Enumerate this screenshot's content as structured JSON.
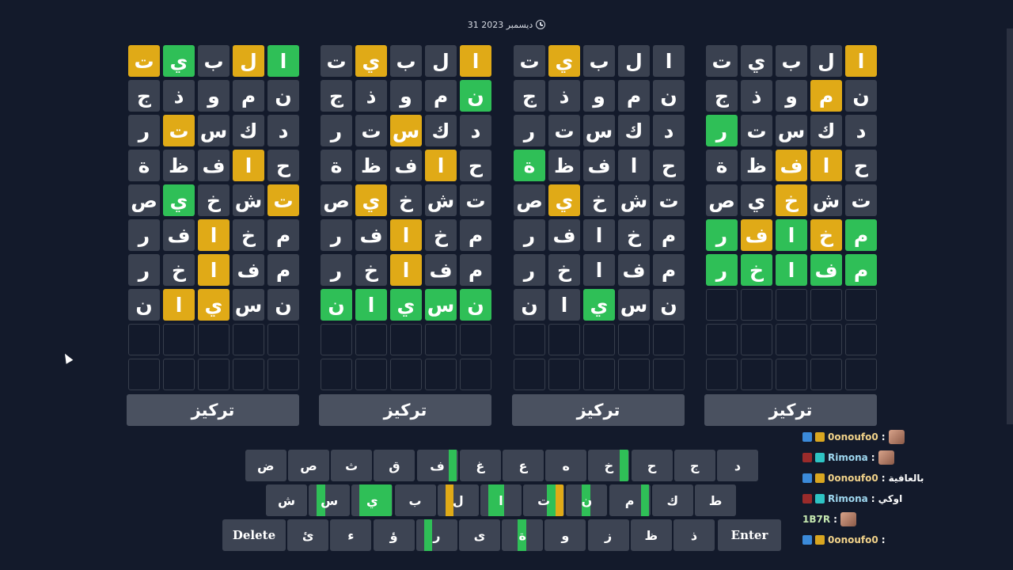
{
  "date": "31 ديسمبر 2023",
  "boards": [
    {
      "rows": [
        [
          [
            "ا",
            "y"
          ],
          [
            "ل",
            ""
          ],
          [
            "ب",
            ""
          ],
          [
            "ي",
            ""
          ],
          [
            "ت",
            ""
          ]
        ],
        [
          [
            "ن",
            ""
          ],
          [
            "م",
            "y"
          ],
          [
            "و",
            ""
          ],
          [
            "ذ",
            ""
          ],
          [
            "ج",
            ""
          ]
        ],
        [
          [
            "د",
            ""
          ],
          [
            "ك",
            ""
          ],
          [
            "س",
            ""
          ],
          [
            "ت",
            ""
          ],
          [
            "ر",
            "g"
          ]
        ],
        [
          [
            "ح",
            ""
          ],
          [
            "ا",
            "y"
          ],
          [
            "ف",
            "y"
          ],
          [
            "ظ",
            ""
          ],
          [
            "ة",
            ""
          ]
        ],
        [
          [
            "ت",
            ""
          ],
          [
            "ش",
            ""
          ],
          [
            "خ",
            "y"
          ],
          [
            "ي",
            ""
          ],
          [
            "ص",
            ""
          ]
        ],
        [
          [
            "م",
            "g"
          ],
          [
            "خ",
            "y"
          ],
          [
            "ا",
            "g"
          ],
          [
            "ف",
            "y"
          ],
          [
            "ر",
            "g"
          ]
        ],
        [
          [
            "م",
            "g"
          ],
          [
            "ف",
            "g"
          ],
          [
            "ا",
            "g"
          ],
          [
            "خ",
            "g"
          ],
          [
            "ر",
            "g"
          ]
        ],
        [
          [
            "",
            "e"
          ],
          [
            "",
            "e"
          ],
          [
            "",
            "e"
          ],
          [
            "",
            "e"
          ],
          [
            "",
            "e"
          ]
        ],
        [
          [
            "",
            "e"
          ],
          [
            "",
            "e"
          ],
          [
            "",
            "e"
          ],
          [
            "",
            "e"
          ],
          [
            "",
            "e"
          ]
        ],
        [
          [
            "",
            "e"
          ],
          [
            "",
            "e"
          ],
          [
            "",
            "e"
          ],
          [
            "",
            "e"
          ],
          [
            "",
            "e"
          ]
        ]
      ],
      "button": "تركيز"
    },
    {
      "rows": [
        [
          [
            "ا",
            ""
          ],
          [
            "ل",
            ""
          ],
          [
            "ب",
            ""
          ],
          [
            "ي",
            "y"
          ],
          [
            "ت",
            ""
          ]
        ],
        [
          [
            "ن",
            ""
          ],
          [
            "م",
            ""
          ],
          [
            "و",
            ""
          ],
          [
            "ذ",
            ""
          ],
          [
            "ج",
            ""
          ]
        ],
        [
          [
            "د",
            ""
          ],
          [
            "ك",
            ""
          ],
          [
            "س",
            ""
          ],
          [
            "ت",
            ""
          ],
          [
            "ر",
            ""
          ]
        ],
        [
          [
            "ح",
            ""
          ],
          [
            "ا",
            ""
          ],
          [
            "ف",
            ""
          ],
          [
            "ظ",
            ""
          ],
          [
            "ة",
            "g"
          ]
        ],
        [
          [
            "ت",
            ""
          ],
          [
            "ش",
            ""
          ],
          [
            "خ",
            ""
          ],
          [
            "ي",
            "y"
          ],
          [
            "ص",
            ""
          ]
        ],
        [
          [
            "م",
            ""
          ],
          [
            "خ",
            ""
          ],
          [
            "ا",
            ""
          ],
          [
            "ف",
            ""
          ],
          [
            "ر",
            ""
          ]
        ],
        [
          [
            "م",
            ""
          ],
          [
            "ف",
            ""
          ],
          [
            "ا",
            ""
          ],
          [
            "خ",
            ""
          ],
          [
            "ر",
            ""
          ]
        ],
        [
          [
            "ن",
            ""
          ],
          [
            "س",
            ""
          ],
          [
            "ي",
            "g"
          ],
          [
            "ا",
            ""
          ],
          [
            "ن",
            ""
          ]
        ],
        [
          [
            "",
            "e"
          ],
          [
            "",
            "e"
          ],
          [
            "",
            "e"
          ],
          [
            "",
            "e"
          ],
          [
            "",
            "e"
          ]
        ],
        [
          [
            "",
            "e"
          ],
          [
            "",
            "e"
          ],
          [
            "",
            "e"
          ],
          [
            "",
            "e"
          ],
          [
            "",
            "e"
          ]
        ]
      ],
      "button": "تركيز"
    },
    {
      "rows": [
        [
          [
            "ا",
            "y"
          ],
          [
            "ل",
            ""
          ],
          [
            "ب",
            ""
          ],
          [
            "ي",
            "y"
          ],
          [
            "ت",
            ""
          ]
        ],
        [
          [
            "ن",
            "g"
          ],
          [
            "م",
            ""
          ],
          [
            "و",
            ""
          ],
          [
            "ذ",
            ""
          ],
          [
            "ج",
            ""
          ]
        ],
        [
          [
            "د",
            ""
          ],
          [
            "ك",
            ""
          ],
          [
            "س",
            "y"
          ],
          [
            "ت",
            ""
          ],
          [
            "ر",
            ""
          ]
        ],
        [
          [
            "ح",
            ""
          ],
          [
            "ا",
            "y"
          ],
          [
            "ف",
            ""
          ],
          [
            "ظ",
            ""
          ],
          [
            "ة",
            ""
          ]
        ],
        [
          [
            "ت",
            ""
          ],
          [
            "ش",
            ""
          ],
          [
            "خ",
            ""
          ],
          [
            "ي",
            "y"
          ],
          [
            "ص",
            ""
          ]
        ],
        [
          [
            "م",
            ""
          ],
          [
            "خ",
            ""
          ],
          [
            "ا",
            "y"
          ],
          [
            "ف",
            ""
          ],
          [
            "ر",
            ""
          ]
        ],
        [
          [
            "م",
            ""
          ],
          [
            "ف",
            ""
          ],
          [
            "ا",
            "y"
          ],
          [
            "خ",
            ""
          ],
          [
            "ر",
            ""
          ]
        ],
        [
          [
            "ن",
            "g"
          ],
          [
            "س",
            "g"
          ],
          [
            "ي",
            "g"
          ],
          [
            "ا",
            "g"
          ],
          [
            "ن",
            "g"
          ]
        ],
        [
          [
            "",
            "e"
          ],
          [
            "",
            "e"
          ],
          [
            "",
            "e"
          ],
          [
            "",
            "e"
          ],
          [
            "",
            "e"
          ]
        ],
        [
          [
            "",
            "e"
          ],
          [
            "",
            "e"
          ],
          [
            "",
            "e"
          ],
          [
            "",
            "e"
          ],
          [
            "",
            "e"
          ]
        ]
      ],
      "button": "تركيز"
    },
    {
      "rows": [
        [
          [
            "ا",
            "g"
          ],
          [
            "ل",
            "y"
          ],
          [
            "ب",
            ""
          ],
          [
            "ي",
            "g"
          ],
          [
            "ت",
            "y"
          ]
        ],
        [
          [
            "ن",
            ""
          ],
          [
            "م",
            ""
          ],
          [
            "و",
            ""
          ],
          [
            "ذ",
            ""
          ],
          [
            "ج",
            ""
          ]
        ],
        [
          [
            "د",
            ""
          ],
          [
            "ك",
            ""
          ],
          [
            "س",
            ""
          ],
          [
            "ت",
            "y"
          ],
          [
            "ر",
            ""
          ]
        ],
        [
          [
            "ح",
            ""
          ],
          [
            "ا",
            "y"
          ],
          [
            "ف",
            ""
          ],
          [
            "ظ",
            ""
          ],
          [
            "ة",
            ""
          ]
        ],
        [
          [
            "ت",
            "y"
          ],
          [
            "ش",
            ""
          ],
          [
            "خ",
            ""
          ],
          [
            "ي",
            "g"
          ],
          [
            "ص",
            ""
          ]
        ],
        [
          [
            "م",
            ""
          ],
          [
            "خ",
            ""
          ],
          [
            "ا",
            "y"
          ],
          [
            "ف",
            ""
          ],
          [
            "ر",
            ""
          ]
        ],
        [
          [
            "م",
            ""
          ],
          [
            "ف",
            ""
          ],
          [
            "ا",
            "y"
          ],
          [
            "خ",
            ""
          ],
          [
            "ر",
            ""
          ]
        ],
        [
          [
            "ن",
            ""
          ],
          [
            "س",
            ""
          ],
          [
            "ي",
            "y"
          ],
          [
            "ا",
            "y"
          ],
          [
            "ن",
            ""
          ]
        ],
        [
          [
            "",
            "e"
          ],
          [
            "",
            "e"
          ],
          [
            "",
            "e"
          ],
          [
            "",
            "e"
          ],
          [
            "",
            "e"
          ]
        ],
        [
          [
            "",
            "e"
          ],
          [
            "",
            "e"
          ],
          [
            "",
            "e"
          ],
          [
            "",
            "e"
          ],
          [
            "",
            "e"
          ]
        ]
      ],
      "button": "تركيز"
    }
  ],
  "keyboard": {
    "row1": [
      {
        "k": "د",
        "segs": []
      },
      {
        "k": "ج",
        "segs": []
      },
      {
        "k": "ح",
        "segs": []
      },
      {
        "k": "خ",
        "segs": [
          [
            "g",
            0
          ]
        ]
      },
      {
        "k": "ه",
        "segs": []
      },
      {
        "k": "ع",
        "segs": []
      },
      {
        "k": "غ",
        "segs": []
      },
      {
        "k": "ف",
        "segs": [
          [
            "g",
            0
          ]
        ]
      },
      {
        "k": "ق",
        "segs": []
      },
      {
        "k": "ث",
        "segs": []
      },
      {
        "k": "ص",
        "segs": []
      },
      {
        "k": "ض",
        "segs": []
      }
    ],
    "row2": [
      {
        "k": "ط",
        "segs": []
      },
      {
        "k": "ك",
        "segs": []
      },
      {
        "k": "م",
        "segs": [
          [
            "g",
            0
          ]
        ]
      },
      {
        "k": "ن",
        "segs": [
          [
            "g",
            2
          ]
        ]
      },
      {
        "k": "ت",
        "segs": [
          [
            "y",
            0
          ],
          [
            "g",
            1
          ]
        ]
      },
      {
        "k": "ا",
        "segs": [
          [
            "g",
            2
          ],
          [
            "g",
            3
          ]
        ]
      },
      {
        "k": "ل",
        "segs": [
          [
            "y",
            3
          ]
        ]
      },
      {
        "k": "ب",
        "segs": []
      },
      {
        "k": "ي",
        "segs": [
          [
            "g",
            0
          ],
          [
            "g",
            1
          ],
          [
            "g",
            2
          ],
          [
            "g",
            3
          ]
        ]
      },
      {
        "k": "س",
        "segs": [
          [
            "g",
            3
          ]
        ]
      },
      {
        "k": "ش",
        "segs": []
      }
    ],
    "row3": [
      {
        "k": "ذ",
        "segs": []
      },
      {
        "k": "ظ",
        "segs": []
      },
      {
        "k": "ز",
        "segs": []
      },
      {
        "k": "و",
        "segs": []
      },
      {
        "k": "ة",
        "segs": [
          [
            "g",
            2
          ]
        ]
      },
      {
        "k": "ى",
        "segs": []
      },
      {
        "k": "ر",
        "segs": [
          [
            "g",
            3
          ]
        ]
      },
      {
        "k": "ؤ",
        "segs": []
      },
      {
        "k": "ء",
        "segs": []
      },
      {
        "k": "ئ",
        "segs": []
      }
    ],
    "enter": "Enter",
    "delete": "Delete"
  },
  "chat": [
    {
      "user": "0onoufo0",
      "sep": " :",
      "msg": "",
      "badges": [
        "blue",
        "gold"
      ],
      "avatar": true
    },
    {
      "user": "Rimona",
      "sep": " :",
      "msg": "",
      "badges": [
        "red",
        "teal"
      ],
      "avatar": true
    },
    {
      "user": "0onoufo0",
      "sep": " :",
      "msg": "بالعافية",
      "badges": [
        "blue",
        "gold"
      ],
      "avatar": false
    },
    {
      "user": "Rimona",
      "sep": " :",
      "msg": "اوكي",
      "badges": [
        "red",
        "teal"
      ],
      "avatar": false
    },
    {
      "user": "1B7R",
      "sep": " :",
      "msg": "",
      "badges": [],
      "avatar": true
    },
    {
      "user": "0onoufo0",
      "sep": " :",
      "msg": "",
      "badges": [
        "blue",
        "gold"
      ],
      "avatar": false
    }
  ]
}
